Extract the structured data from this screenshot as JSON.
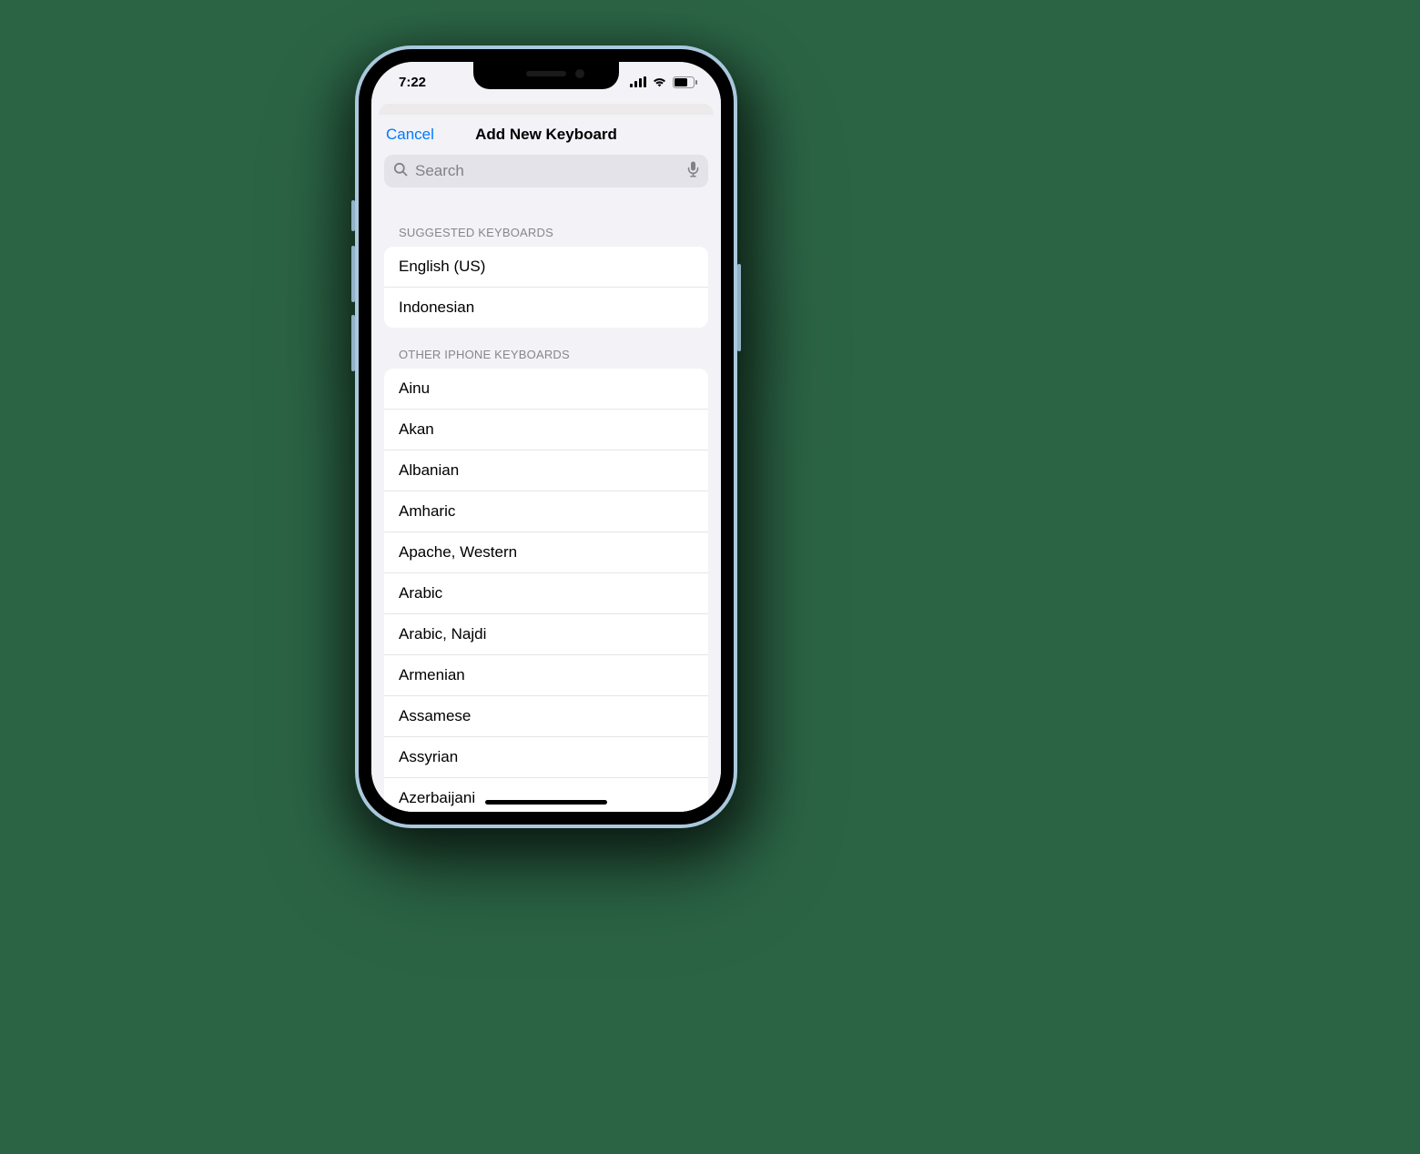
{
  "status": {
    "time": "7:22"
  },
  "nav": {
    "cancel": "Cancel",
    "title": "Add New Keyboard"
  },
  "search": {
    "placeholder": "Search"
  },
  "sections": {
    "suggested": {
      "header": "SUGGESTED KEYBOARDS",
      "items": [
        "English (US)",
        "Indonesian"
      ]
    },
    "other": {
      "header": "OTHER IPHONE KEYBOARDS",
      "items": [
        "Ainu",
        "Akan",
        "Albanian",
        "Amharic",
        "Apache, Western",
        "Arabic",
        "Arabic, Najdi",
        "Armenian",
        "Assamese",
        "Assyrian",
        "Azerbaijani"
      ]
    }
  }
}
